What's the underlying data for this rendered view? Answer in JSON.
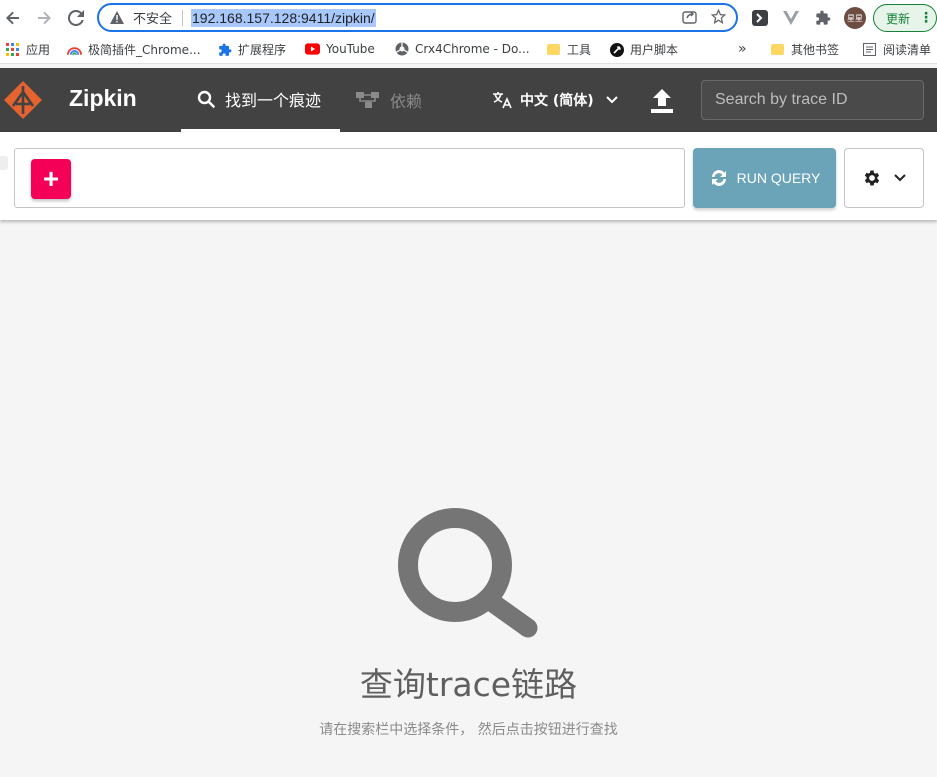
{
  "browser": {
    "insecure_label": "不安全",
    "url": "192.168.157.128:9411/zipkin/",
    "avatar_text": "星星",
    "update_label": "更新",
    "update_menu": "⋮",
    "more_bookmarks": "»"
  },
  "bookmarks": [
    {
      "label": "应用",
      "icon": "apps-grid-icon"
    },
    {
      "label": "极简插件_Chrome...",
      "icon": "rainbow-icon"
    },
    {
      "label": "扩展程序",
      "icon": "puzzle-icon"
    },
    {
      "label": "YouTube",
      "icon": "youtube-icon"
    },
    {
      "label": "Crx4Chrome - Do...",
      "icon": "crx-icon"
    },
    {
      "label": "工具",
      "icon": "folder-icon"
    },
    {
      "label": "用户脚本",
      "icon": "script-icon"
    },
    {
      "label": "其他书签",
      "icon": "folder-icon"
    },
    {
      "label": "阅读清单",
      "icon": "reading-list-icon"
    }
  ],
  "zipkin": {
    "title": "Zipkin",
    "tabs": [
      {
        "label": "找到一个痕迹",
        "icon": "search-icon",
        "active": true
      },
      {
        "label": "依赖",
        "icon": "dependency-icon",
        "active": false
      }
    ],
    "language": "中文 (简体)",
    "trace_search_placeholder": "Search by trace ID"
  },
  "query": {
    "add_label": "+",
    "run_label": "RUN QUERY"
  },
  "empty_state": {
    "title": "查询trace链路",
    "description": "请在搜索栏中选择条件， 然后点击按钮进行查找"
  },
  "colors": {
    "header_bg": "#424242",
    "add_button": "#f50057",
    "run_button": "#6ba3b8",
    "logo": "#e5632e"
  }
}
